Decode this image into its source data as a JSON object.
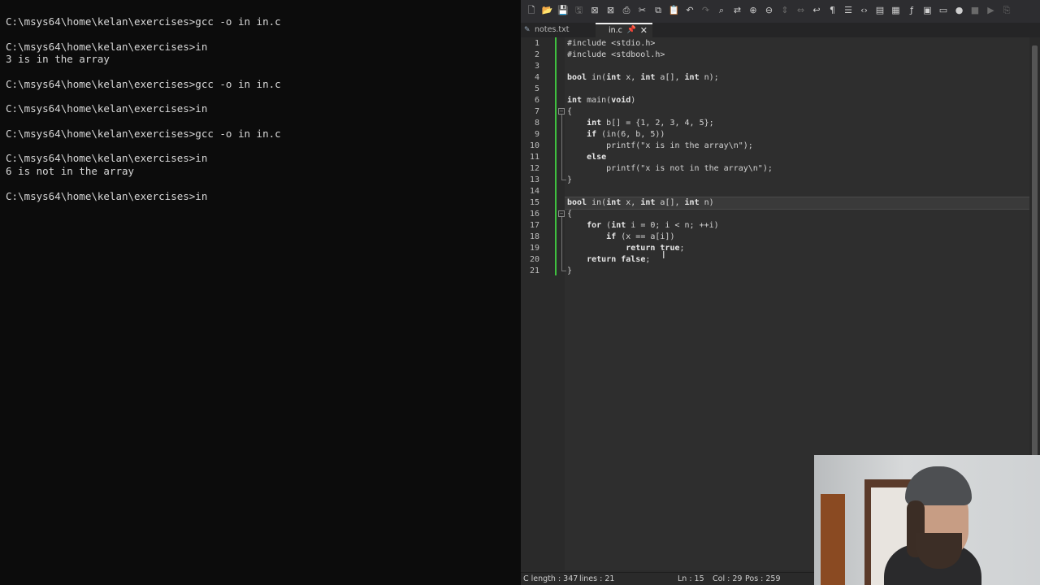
{
  "terminal": {
    "lines": [
      "C:\\msys64\\home\\kelan\\exercises>gcc -o in in.c",
      "",
      "C:\\msys64\\home\\kelan\\exercises>in",
      "3 is in the array",
      "",
      "C:\\msys64\\home\\kelan\\exercises>gcc -o in in.c",
      "",
      "C:\\msys64\\home\\kelan\\exercises>in",
      "",
      "C:\\msys64\\home\\kelan\\exercises>gcc -o in in.c",
      "",
      "C:\\msys64\\home\\kelan\\exercises>in",
      "6 is not in the array",
      "",
      "C:\\msys64\\home\\kelan\\exercises>in"
    ]
  },
  "editor": {
    "tabs": [
      {
        "label": "notes.txt"
      },
      {
        "label": "in.c"
      }
    ],
    "tab_close_glyph": "✕",
    "code": [
      {
        "n": "1",
        "text": "#include <stdio.h>"
      },
      {
        "n": "2",
        "text": "#include <stdbool.h>"
      },
      {
        "n": "3",
        "text": ""
      },
      {
        "n": "4",
        "text": "bool in(int x, int a[], int n);"
      },
      {
        "n": "5",
        "text": ""
      },
      {
        "n": "6",
        "text": "int main(void)"
      },
      {
        "n": "7",
        "text": "{"
      },
      {
        "n": "8",
        "text": "    int b[] = {1, 2, 3, 4, 5};"
      },
      {
        "n": "9",
        "text": "    if (in(6, b, 5))"
      },
      {
        "n": "10",
        "text": "        printf(\"x is in the array\\n\");"
      },
      {
        "n": "11",
        "text": "    else"
      },
      {
        "n": "12",
        "text": "        printf(\"x is not in the array\\n\");"
      },
      {
        "n": "13",
        "text": "}"
      },
      {
        "n": "14",
        "text": ""
      },
      {
        "n": "15",
        "text": "bool in(int x, int a[], int n)"
      },
      {
        "n": "16",
        "text": "{"
      },
      {
        "n": "17",
        "text": "    for (int i = 0; i < n; ++i)"
      },
      {
        "n": "18",
        "text": "        if (x == a[i])"
      },
      {
        "n": "19",
        "text": "            return true;"
      },
      {
        "n": "20",
        "text": "    return false;"
      },
      {
        "n": "21",
        "text": "}"
      }
    ],
    "status": {
      "length": "C length : 347",
      "lines": "lines : 21",
      "ln": "Ln : 15",
      "col": "Col : 29",
      "pos": "Pos : 259"
    },
    "toolbar_icons": [
      "new-file-icon",
      "open-folder-icon",
      "save-icon",
      "save-all-icon",
      "close-icon",
      "close-all-icon",
      "print-icon",
      "cut-icon",
      "copy-icon",
      "paste-icon",
      "undo-icon",
      "redo-icon",
      "find-icon",
      "replace-icon",
      "zoom-in-icon",
      "zoom-out-icon",
      "sync-v-icon",
      "sync-h-icon",
      "word-wrap-icon",
      "show-all-chars-icon",
      "indent-guide-icon",
      "xml-icon",
      "map-icon",
      "doc-list-icon",
      "function-list-icon",
      "folder-workspace-icon",
      "monitor-icon",
      "record-macro-icon",
      "stop-macro-icon",
      "play-macro-icon",
      "save-macro-icon"
    ]
  }
}
